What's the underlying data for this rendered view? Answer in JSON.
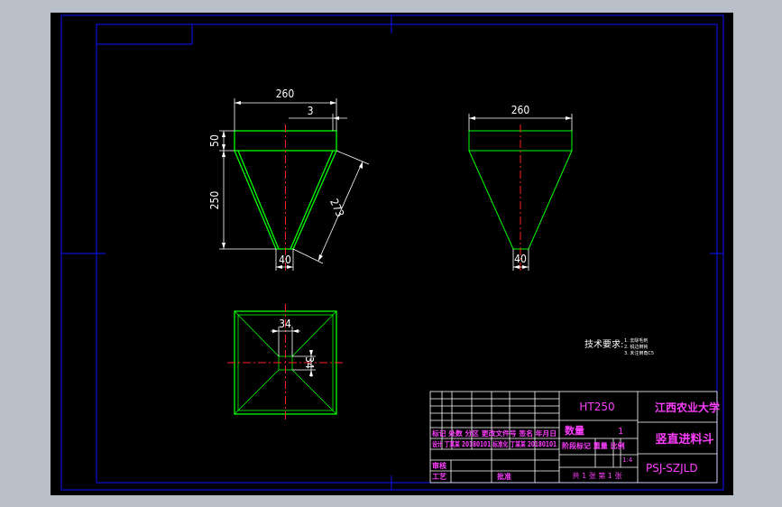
{
  "drawing": {
    "views": {
      "front": {
        "dim_top_width": "260",
        "dim_wall": "3",
        "dim_rim_height": "50",
        "dim_cone_height": "250",
        "dim_slant": "273",
        "dim_bottom_width": "40"
      },
      "side": {
        "dim_top_width": "260",
        "dim_bottom_width": "40"
      },
      "top": {
        "dim_outlet_width": "34",
        "dim_outlet_height": "34"
      }
    },
    "tech_requirements": {
      "heading": "技术要求:",
      "item1": "1. 去除毛刺",
      "item2": "2. 锐边倒钝",
      "item3": "3. 未注倒角C5"
    },
    "title_block": {
      "material": "HT250",
      "university": "江西农业大学",
      "part_name": "竖直进料斗",
      "drawing_no": "PSJ-SZJLD",
      "qty_label": "数量",
      "qty_value": "1",
      "scale_value": "1:4",
      "sheet_info": "共 1 张 第 1 张",
      "row_revision": "标记 处数 分区 更改文件号 签名 年月日",
      "row_design": "设计 丁某某 20180101 标准化 丁某某 20180101",
      "row_stage": "阶段标记 重量 比例",
      "label_review": "审核",
      "label_process": "工艺",
      "label_approve": "批准"
    }
  }
}
